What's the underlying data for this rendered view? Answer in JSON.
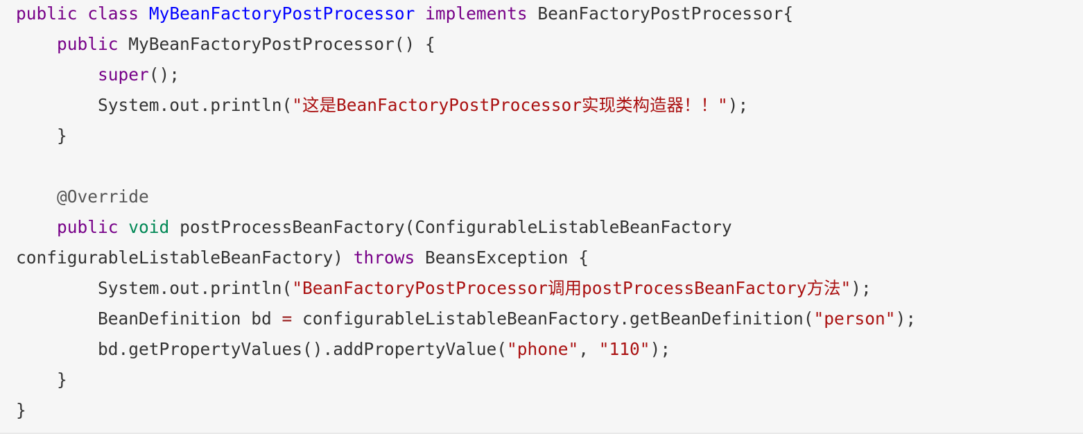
{
  "code": {
    "language": "java",
    "lines": [
      [
        {
          "t": "public",
          "k": "keyword"
        },
        {
          "t": " ",
          "k": "plain"
        },
        {
          "t": "class",
          "k": "keyword"
        },
        {
          "t": " ",
          "k": "plain"
        },
        {
          "t": "MyBeanFactoryPostProcessor",
          "k": "def"
        },
        {
          "t": " ",
          "k": "plain"
        },
        {
          "t": "implements",
          "k": "keyword"
        },
        {
          "t": " BeanFactoryPostProcessor{",
          "k": "plain"
        }
      ],
      [
        {
          "t": "    ",
          "k": "plain"
        },
        {
          "t": "public",
          "k": "keyword"
        },
        {
          "t": " MyBeanFactoryPostProcessor() {",
          "k": "plain"
        }
      ],
      [
        {
          "t": "        ",
          "k": "plain"
        },
        {
          "t": "super",
          "k": "keyword"
        },
        {
          "t": "();",
          "k": "plain"
        }
      ],
      [
        {
          "t": "        System.out.println(",
          "k": "plain"
        },
        {
          "t": "\"这是BeanFactoryPostProcessor实现类构造器！！\"",
          "k": "string"
        },
        {
          "t": ");",
          "k": "plain"
        }
      ],
      [
        {
          "t": "    }",
          "k": "plain"
        }
      ],
      [],
      [
        {
          "t": "    ",
          "k": "plain"
        },
        {
          "t": "@Override",
          "k": "meta"
        }
      ],
      [
        {
          "t": "    ",
          "k": "plain"
        },
        {
          "t": "public",
          "k": "keyword"
        },
        {
          "t": " ",
          "k": "plain"
        },
        {
          "t": "void",
          "k": "typekw"
        },
        {
          "t": " postProcessBeanFactory(ConfigurableListableBeanFactory",
          "k": "plain"
        }
      ],
      [
        {
          "t": "configurableListableBeanFactory) ",
          "k": "plain"
        },
        {
          "t": "throws",
          "k": "keyword"
        },
        {
          "t": " BeansException {",
          "k": "plain"
        }
      ],
      [
        {
          "t": "        System.out.println(",
          "k": "plain"
        },
        {
          "t": "\"BeanFactoryPostProcessor调用postProcessBeanFactory方法\"",
          "k": "string"
        },
        {
          "t": ");",
          "k": "plain"
        }
      ],
      [
        {
          "t": "        BeanDefinition bd ",
          "k": "plain"
        },
        {
          "t": "=",
          "k": "op"
        },
        {
          "t": " configurableListableBeanFactory.getBeanDefinition(",
          "k": "plain"
        },
        {
          "t": "\"person\"",
          "k": "string"
        },
        {
          "t": ");",
          "k": "plain"
        }
      ],
      [
        {
          "t": "        bd.getPropertyValues().addPropertyValue(",
          "k": "plain"
        },
        {
          "t": "\"phone\"",
          "k": "string"
        },
        {
          "t": ", ",
          "k": "plain"
        },
        {
          "t": "\"110\"",
          "k": "string"
        },
        {
          "t": ");",
          "k": "plain"
        }
      ],
      [
        {
          "t": "    }",
          "k": "plain"
        }
      ],
      [
        {
          "t": "}",
          "k": "plain"
        }
      ]
    ]
  }
}
